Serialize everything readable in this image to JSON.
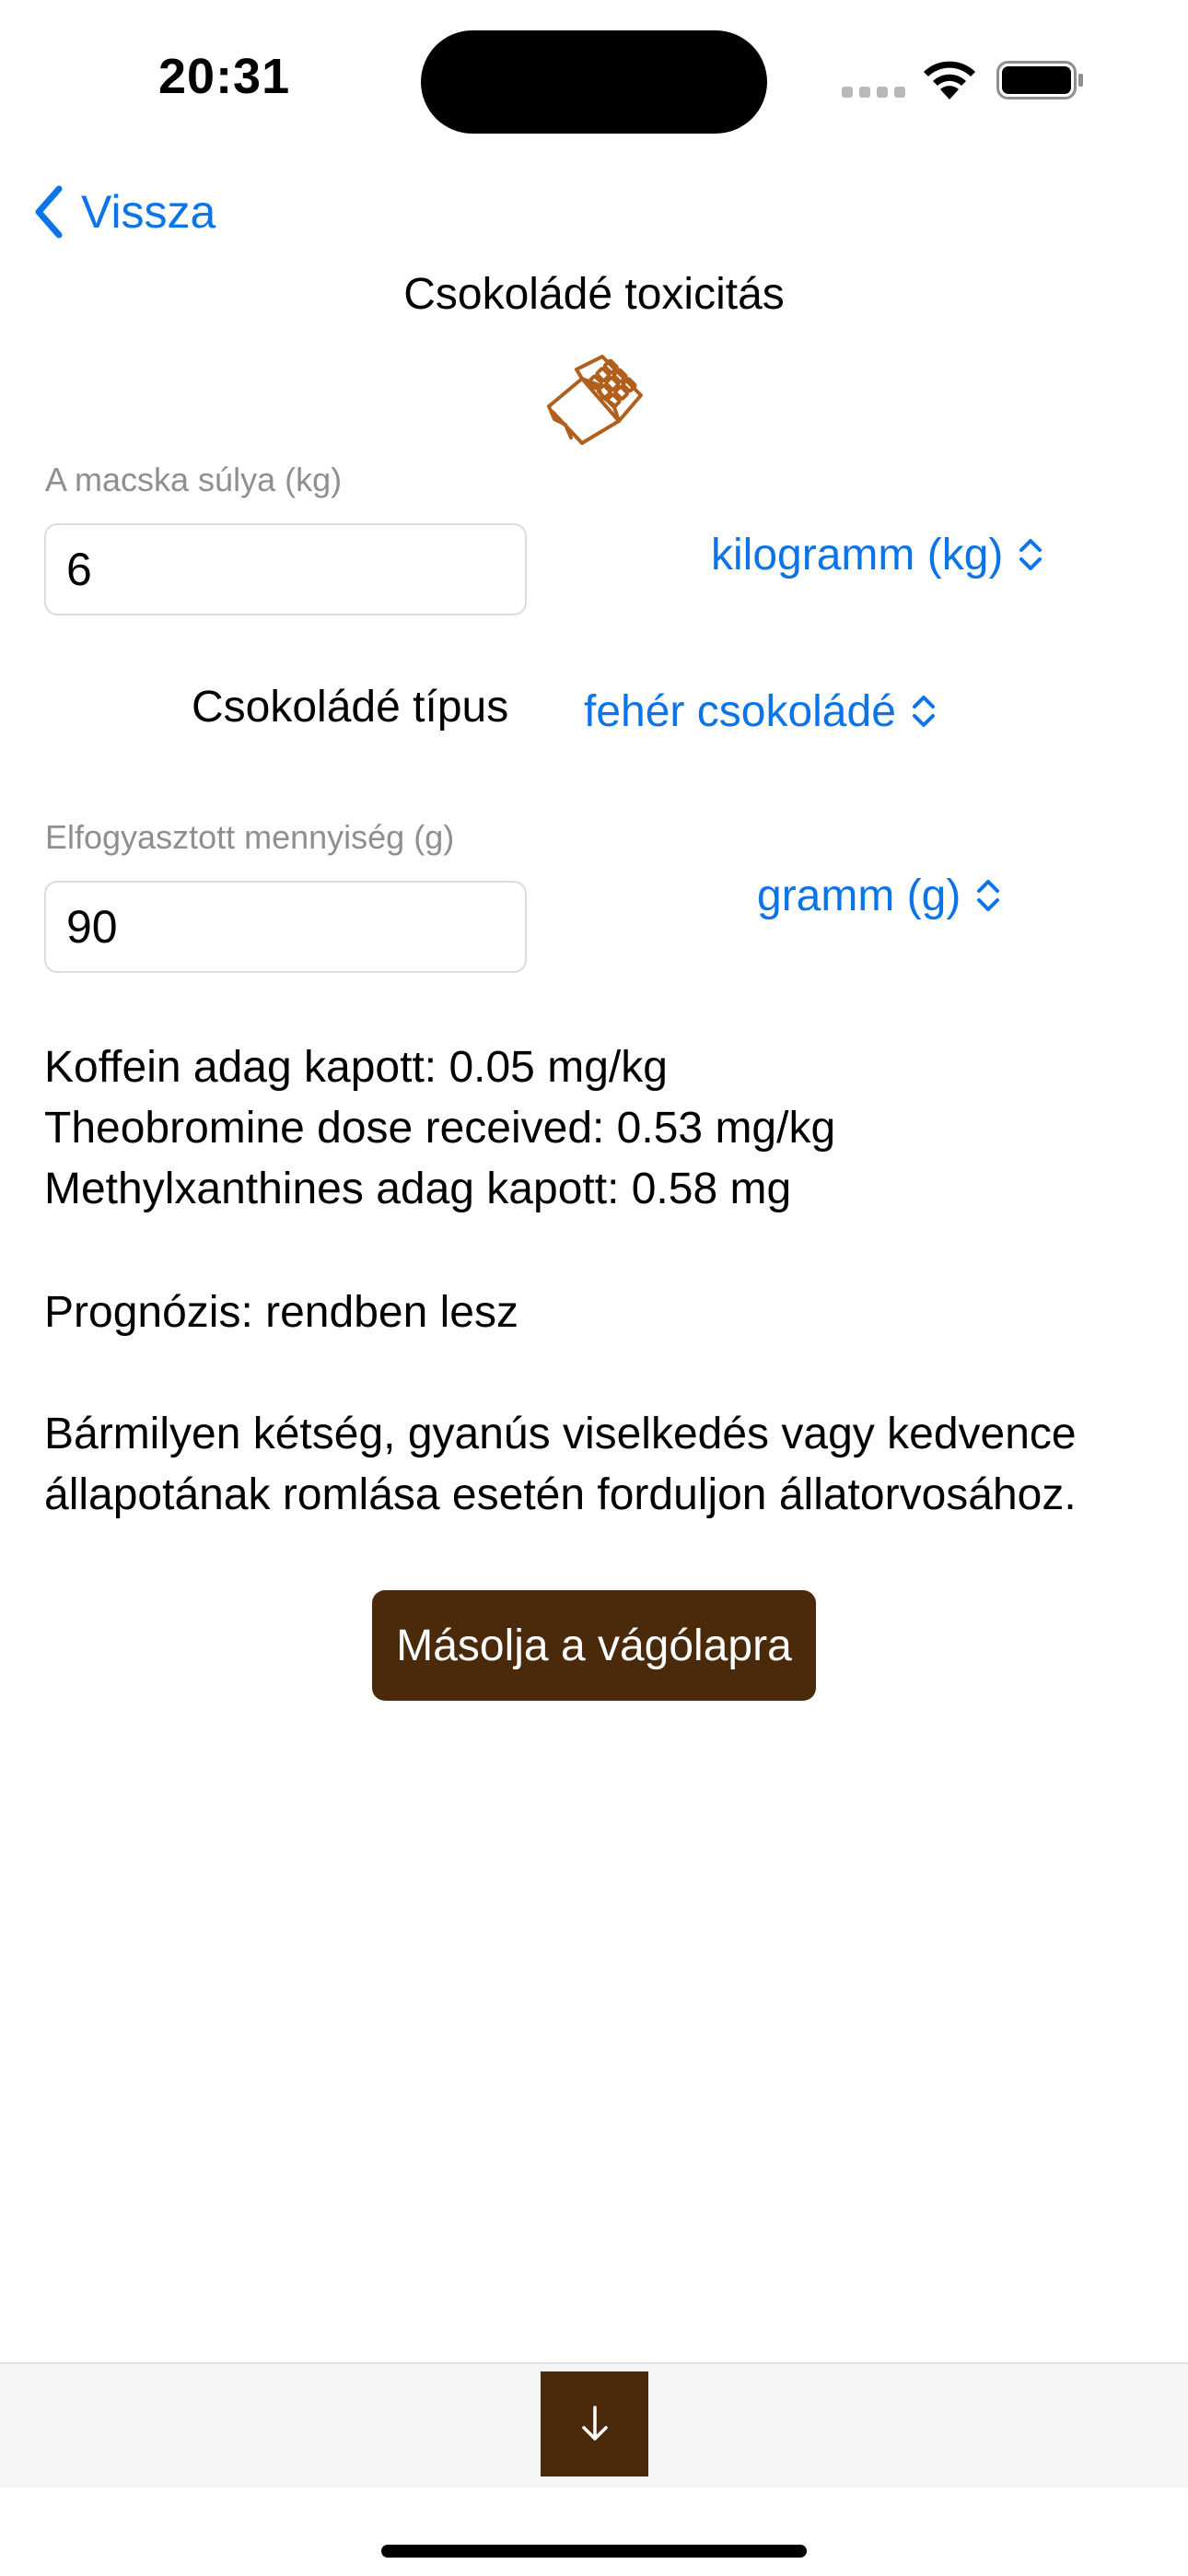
{
  "status_bar": {
    "time": "20:31"
  },
  "nav": {
    "back_label": "Vissza"
  },
  "page": {
    "title": "Csokoládé toxicitás"
  },
  "weight": {
    "label": "A macska súlya (kg)",
    "value": "6",
    "unit_picker": "kilogramm (kg)"
  },
  "chocolate": {
    "label": "Csokoládé típus",
    "type_picker": "fehér csokoládé"
  },
  "amount": {
    "label": "Elfogyasztott mennyiség (g)",
    "value": "90",
    "unit_picker": "gramm (g)"
  },
  "results": {
    "caffeine": "Koffein adag kapott: 0.05 mg/kg",
    "theobromine": "Theobromine dose received: 0.53 mg/kg",
    "methylxanthines": "Methylxanthines adag kapott: 0.58 mg"
  },
  "prognosis": "Prognózis: rendben lesz",
  "advice": "Bármilyen kétség, gyanús viselkedés vagy kedvence állapotának romlása esetén forduljon állatorvosához.",
  "actions": {
    "copy_label": "Másolja a vágólapra"
  },
  "colors": {
    "accent": "#0a74e8",
    "brand_brown": "#4a2a0a",
    "icon_brown": "#b0601c"
  }
}
